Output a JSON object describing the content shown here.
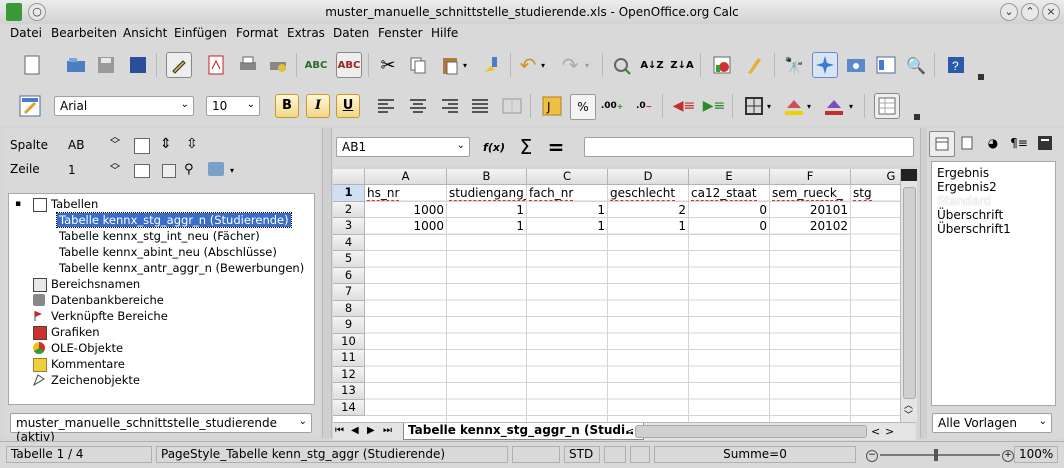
{
  "window": {
    "title": "muster_manuelle_schnittstelle_studierende.xls - OpenOffice.org Calc"
  },
  "menu": [
    "Datei",
    "Bearbeiten",
    "Ansicht",
    "Einfügen",
    "Format",
    "Extras",
    "Daten",
    "Fenster",
    "Hilfe"
  ],
  "format_bar": {
    "font_name": "Arial",
    "font_size": "10",
    "bold": "B",
    "italic": "I",
    "underline": "U"
  },
  "navigator": {
    "col_label": "Spalte",
    "col_value": "AB",
    "row_label": "Zeile",
    "row_value": "1",
    "tree": {
      "root": "Tabellen",
      "sheets": [
        "Tabelle kennx_stg_aggr_n (Studierende)",
        "Tabelle kennx_stg_int_neu (Fächer)",
        "Tabelle kennx_abint_neu (Abschlüsse)",
        "Tabelle kennx_antr_aggr_n (Bewerbungen)"
      ],
      "categories": [
        "Bereichsnamen",
        "Datenbankbereiche",
        "Verknüpfte Bereiche",
        "Grafiken",
        "OLE-Objekte",
        "Kommentare",
        "Zeichenobjekte"
      ]
    },
    "document_select": "muster_manuelle_schnittstelle_studierende (aktiv)"
  },
  "formula_bar": {
    "name_box": "AB1",
    "input_value": ""
  },
  "sheet": {
    "columns": [
      "A",
      "B",
      "C",
      "D",
      "E",
      "F",
      "G"
    ],
    "rows": [
      "1",
      "2",
      "3",
      "4",
      "5",
      "6",
      "7",
      "8",
      "9",
      "10",
      "11",
      "12",
      "13",
      "14"
    ],
    "header_row": [
      "hs_nr",
      "studiengang_",
      "fach_nr",
      "geschlecht",
      "ca12_staat",
      "sem_rueck_",
      "stg"
    ],
    "data": [
      [
        "1000",
        "1",
        "1",
        "2",
        "0",
        "20101",
        ""
      ],
      [
        "1000",
        "1",
        "1",
        "1",
        "0",
        "20102",
        ""
      ]
    ],
    "tab_label": "Tabelle kennx_stg_aggr_n (Studi..."
  },
  "styles_panel": {
    "items": [
      "Ergebnis",
      "Ergebnis2",
      "Standard",
      "Überschrift",
      "Überschrift1"
    ],
    "filter": "Alle Vorlagen"
  },
  "status": {
    "sheet": "Tabelle 1 / 4",
    "page_style": "PageStyle_Tabelle kenn_stg_aggr (Studierende)",
    "mode": "STD",
    "sum": "Summe=0",
    "zoom": "100%"
  }
}
